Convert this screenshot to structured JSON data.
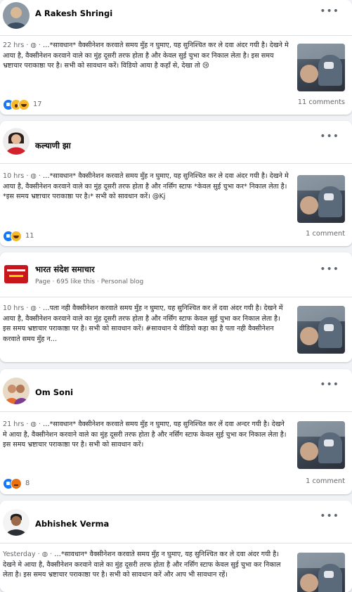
{
  "posts": [
    {
      "author": "A Rakesh Shringi",
      "page_info": "",
      "time": "22 hrs",
      "text": "…*सावधान* वैक्सीनेशन करवाते समय मुँह न घुमाए, यह सुनिश्चित कर ले दवा अंदर गयी है। देखने मे आया है, वैक्सीनेशन करवाने वाले का मुंह दूसरी तरफ होता है और केवल सुई चुभा कर निकाल लेता है। इस समय भ्रष्टाचार पराकाष्ठा पर है। सभी को सावधान करें। विडियो आया है कहाँ से, देखा तो 😢",
      "reactions": [
        "like",
        "wow",
        "haha"
      ],
      "reaction_count": "17",
      "comments": "11 comments"
    },
    {
      "author": "कल्याणी झा",
      "page_info": "",
      "time": "10 hrs",
      "text": "…*सावधान* वैक्सीनेशन करवाते समय मुँह न घुमाए, यह सुनिश्चित कर ले दवा अंदर गयी है। देखने मे आया है, वैक्सीनेशन करवाने वाले का मुंह दूसरी तरफ होता है और नर्सिंग स्टाफ *केवल सुई चुभा कर* निकाल लेता है। *इस समय भ्रष्टाचार पराकाष्ठा पर है।* सभी को सावधान करें। @Kj",
      "reactions": [
        "like",
        "haha"
      ],
      "reaction_count": "11",
      "comments": "1 comment"
    },
    {
      "author": "भारत संदेश समाचार",
      "page_info": "Page · 695 like this · Personal blog",
      "time": "10 hrs",
      "text": "…पता नही वैक्सीनेशन करवाते समय मुँह न घुमाए, यह सुनिश्चित कर लें दवा अंदर गयी है। देखने में आया है, वैक्सीनेशन करवाने वाले का मुंह दूसरी तरफ होता है और नर्सिंग स्टाफ केवल सुई चुभा कर निकाल लेता है। इस समय भ्रष्टाचार पराकाष्ठा पर है। सभी को सावधान करें। #सावधान ये वीडियो कहा का है पता नही वैक्सीनेशन करवाते समय मुँह न…",
      "reactions": [],
      "reaction_count": "",
      "comments": ""
    },
    {
      "author": "Om Soni",
      "page_info": "",
      "time": "21 hrs",
      "text": "…*सावधान* वैक्सीनेशन करवाते समय मुँह न घुमाए, यह सुनिश्चित कर लें दवा अन्दर गयी है। देखने मे आया है, वैक्सीनेशन करवाने वाले का मुंह दूसरी तरफ होता है और नर्सिंग स्टाफ केवल सुई चुभा कर निकाल लेता है। इस समय भ्रष्टाचार पराकाष्ठा पर है। सभी को सावधान करें।",
      "reactions": [
        "like",
        "angry"
      ],
      "reaction_count": "8",
      "comments": "1 comment"
    },
    {
      "author": "Abhishek Verma",
      "page_info": "",
      "time": "Yesterday",
      "text": "…*सावधान* वैक्सीनेशन करवाते समय मुँह न घुमाए, यह सुनिश्चित कर ले दवा अंदर गयी है। देखने मे आया है, वैक्सीनेशन करवाने वाले का मुंह दूसरी तरफ होता है और नर्सिंग स्टाफ केवल सुई चुभा कर निकाल लेता है। इस समय भ्रष्टाचार पराकाष्ठा पर है। सभी को सावधान करें और आप भी सावधान रहें।",
      "reactions": [],
      "reaction_count": "",
      "comments": ""
    }
  ],
  "icons": {
    "globe": "globe-icon",
    "more": "more-options-icon"
  },
  "colors": {
    "like_blue": "#1877f2",
    "haha_yellow": "#f7b928",
    "angry_orange": "#e9710f",
    "meta_gray": "#65676b",
    "bg": "#f0f2f5"
  }
}
